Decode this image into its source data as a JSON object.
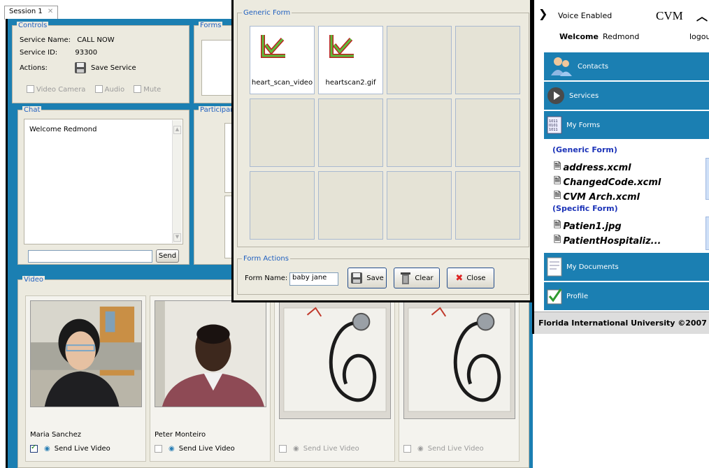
{
  "session_tab": {
    "label": "Session 1"
  },
  "controls": {
    "title": "Controls",
    "service_name_label": "Service Name:",
    "service_name": "CALL NOW",
    "service_id_label": "Service ID:",
    "service_id": "93300",
    "actions_label": "Actions:",
    "save_service": "Save Service",
    "video_camera": "Video Camera",
    "audio": "Audio",
    "mute": "Mute"
  },
  "forms": {
    "title": "Forms"
  },
  "chat": {
    "title": "Chat",
    "message": "Welcome Redmond",
    "input": "",
    "send": "Send"
  },
  "participants": {
    "title": "Participant"
  },
  "video": {
    "title": "Video",
    "tiles": [
      {
        "name": "Maria Sanchez",
        "send": "Send Live Video",
        "checked": true,
        "enabled": true
      },
      {
        "name": "Peter Monteiro",
        "send": "Send Live Video",
        "checked": false,
        "enabled": true
      },
      {
        "name": "",
        "send": "Send Live Video",
        "checked": false,
        "enabled": false
      },
      {
        "name": "",
        "send": "Send Live Video",
        "checked": false,
        "enabled": false
      }
    ]
  },
  "generic_form": {
    "title": "Generic Form",
    "files": [
      "heart_scan_video",
      "heartscan2.gif"
    ]
  },
  "form_actions": {
    "title": "Form Actions",
    "form_name_label": "Form Name:",
    "form_name": "baby jane",
    "save": "Save",
    "clear": "Clear",
    "close": "Close"
  },
  "sidebar": {
    "voice_status": "Voice Enabled",
    "app_name": "CVM",
    "welcome_label": "Welcome",
    "user": "Redmond",
    "logout": "logout",
    "nav": {
      "contacts": "Contacts",
      "services": "Services",
      "my_forms": "My Forms",
      "my_documents": "My Documents",
      "profile": "Profile"
    },
    "generic_group": "(Generic Form)",
    "generic_items": [
      "address.xcml",
      "ChangedCode.xcml",
      "CVM Arch.xcml"
    ],
    "specific_group": "(Specific Form)",
    "specific_items": [
      "Patien1.jpg",
      "PatientHospitaliz..."
    ],
    "footer": "Florida International University ©2007"
  },
  "colors": {
    "accent_blue": "#1b7fb2",
    "panel": "#eceadf",
    "label_blue": "#1f5fbf",
    "group_blue": "#1c33b8"
  }
}
